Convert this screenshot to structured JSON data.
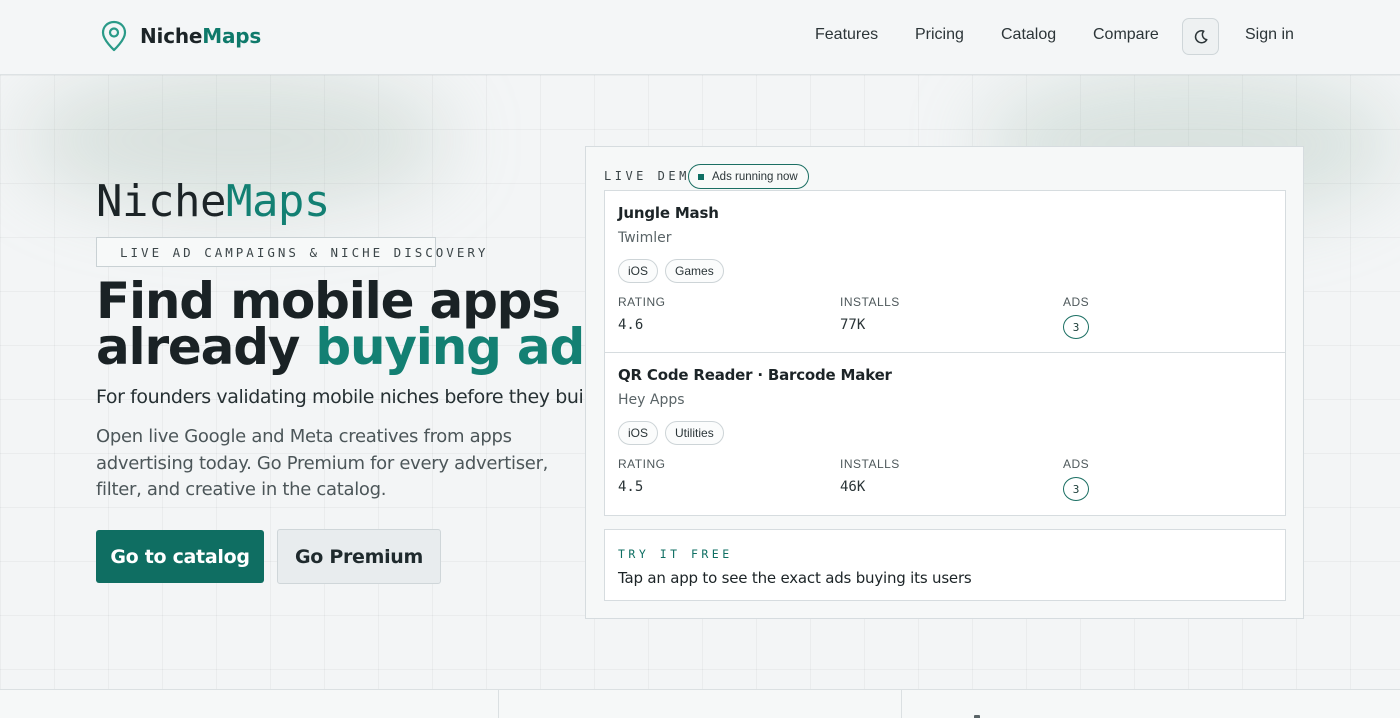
{
  "header": {
    "logo": {
      "part1": "Niche",
      "part2": "Maps",
      "icon": "map-pin-icon"
    },
    "nav": [
      {
        "label": "Features"
      },
      {
        "label": "Pricing"
      },
      {
        "label": "Catalog"
      },
      {
        "label": "Compare"
      }
    ],
    "theme_toggle_icon": "moon-icon",
    "sign_in": "Sign in"
  },
  "hero": {
    "brand": {
      "part1": "Niche",
      "part2": "Maps"
    },
    "tagline": "LIVE AD CAMPAIGNS & NICHE DISCOVERY",
    "headline": {
      "line1": "Find mobile apps",
      "line2_plain": "already",
      "line2_accent": "buying ads"
    },
    "subheadline": "For founders validating mobile niches before they build.",
    "description": "Open live Google and Meta creatives from apps advertising today. Go Premium for every advertiser, filter, and creative in the catalog.",
    "cta_primary": "Go to catalog",
    "cta_secondary": "Go Premium"
  },
  "demo": {
    "label": "LIVE DEMO",
    "status": "Ads running now",
    "apps": [
      {
        "name": "Jungle Mash",
        "developer": "Twimler",
        "tags": [
          "iOS",
          "Games"
        ],
        "rating_label": "RATING",
        "rating": "4.6",
        "installs_label": "INSTALLS",
        "installs": "77K",
        "ads_label": "ADS",
        "ads": "3"
      },
      {
        "name": "QR Code Reader · Barcode Maker",
        "developer": "Hey Apps",
        "tags": [
          "iOS",
          "Utilities"
        ],
        "rating_label": "RATING",
        "rating": "4.5",
        "installs_label": "INSTALLS",
        "installs": "46K",
        "ads_label": "ADS",
        "ads": "3"
      }
    ],
    "try": {
      "label": "TRY IT FREE",
      "text": "Tap an app to see the exact ads buying its users"
    }
  },
  "colors": {
    "accent": "#0f6e62",
    "accent_text": "#138073",
    "background": "#f3f5f6"
  }
}
